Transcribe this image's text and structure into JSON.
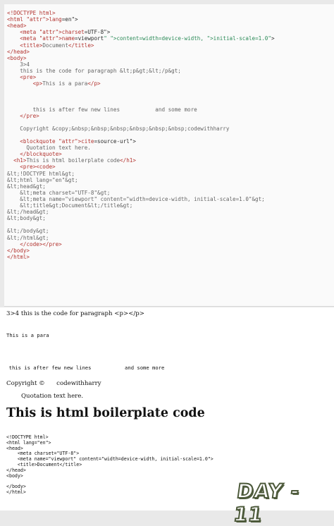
{
  "editor": {
    "lines": [
      "<!DOCTYPE html>",
      "<html lang=\"en\">",
      "<head>",
      "    <meta charset=\"UTF-8\">",
      "    <meta name=\"viewport\" content=\"width=device-width, initial-scale=1.0\">",
      "    <title>Document</title>",
      "</head>",
      "<body>",
      "    3>4",
      "    this is the code for paragraph &lt;p&gt;&lt;/p&gt;",
      "    <pre>",
      "        <p>This is a para</p>",
      "",
      "",
      "",
      "        this is after few new lines           and some more",
      "    </pre>",
      "",
      "    Copyright &copy;&nbsp;&nbsp;&nbsp;&nbsp;&nbsp;&nbsp;codewithharry",
      "",
      "    <blockquote cite=\"source-url\">",
      "      Quotation text here.",
      "    </blockquote>",
      "  <h1>This is html boilerplate code</h1>",
      "    <pre><code>",
      "&lt;!DOCTYPE html&gt;",
      "&lt;html lang=\"en\"&gt;",
      "&lt;head&gt;",
      "    &lt;meta charset=\"UTF-8\"&gt;",
      "    &lt;meta name=\"viewport\" content=\"width=device-width, initial-scale=1.0\"&gt;",
      "    &lt;title&gt;Document&lt;/title&gt;",
      "&lt;/head&gt;",
      "&lt;body&gt;",
      "",
      "&lt;/body&gt;",
      "&lt;/html&gt;",
      "    </code></pre>",
      "</body>",
      "</html>"
    ]
  },
  "preview": {
    "line1": "3>4 this is the code for paragraph <p></p>",
    "para": "This is a para",
    "after_lines": "        this is after few new lines           and some more",
    "copyright": "Copyright ©      codewithharry",
    "quote": "Quotation text here.",
    "heading": "This is html boilerplate code",
    "code_lines": [
      "<!DOCTYPE html>",
      "<html lang=\"en\">",
      "<head>",
      "    <meta charset=\"UTF-8\">",
      "    <meta name=\"viewport\" content=\"width=device-width, initial-scale=1.0\">",
      "    <title>Document</title>",
      "</head>",
      "<body>",
      "",
      "</body>",
      "</html>"
    ]
  },
  "badge": {
    "text": "DAY - 11"
  }
}
